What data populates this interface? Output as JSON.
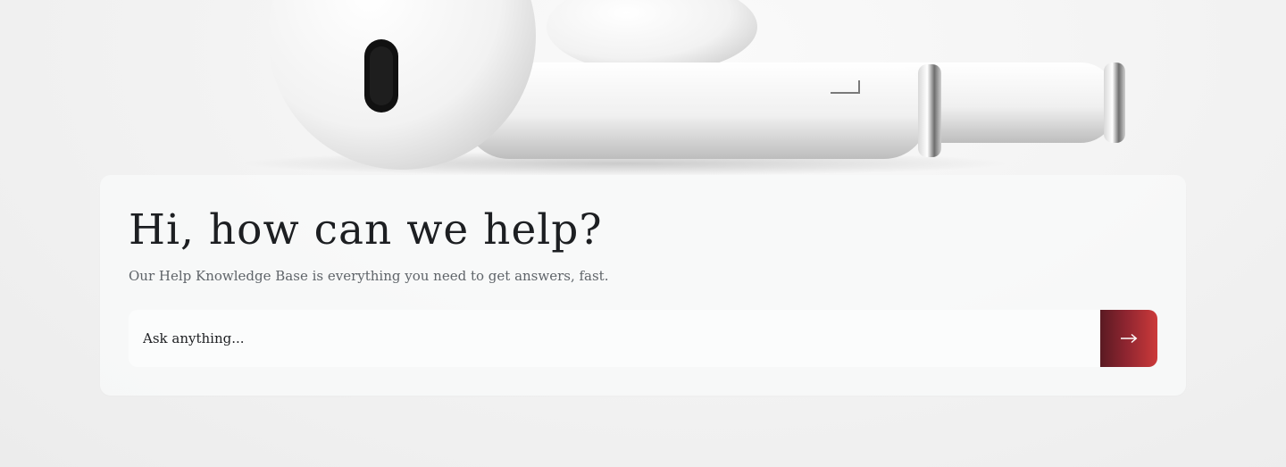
{
  "hero": {
    "image_alt": "White earbuds on a light background"
  },
  "help": {
    "title": "Hi, how can we help?",
    "subtitle": "Our Help Knowledge Base is everything you need to get answers, fast.",
    "search": {
      "placeholder": "Ask anything...",
      "value": "",
      "submit_icon": "arrow-right-icon"
    }
  },
  "colors": {
    "accent_dark": "#5a1a22",
    "accent_light": "#cc3a3a",
    "title_text": "#1d1f22",
    "subtitle_text": "#5f6469"
  }
}
